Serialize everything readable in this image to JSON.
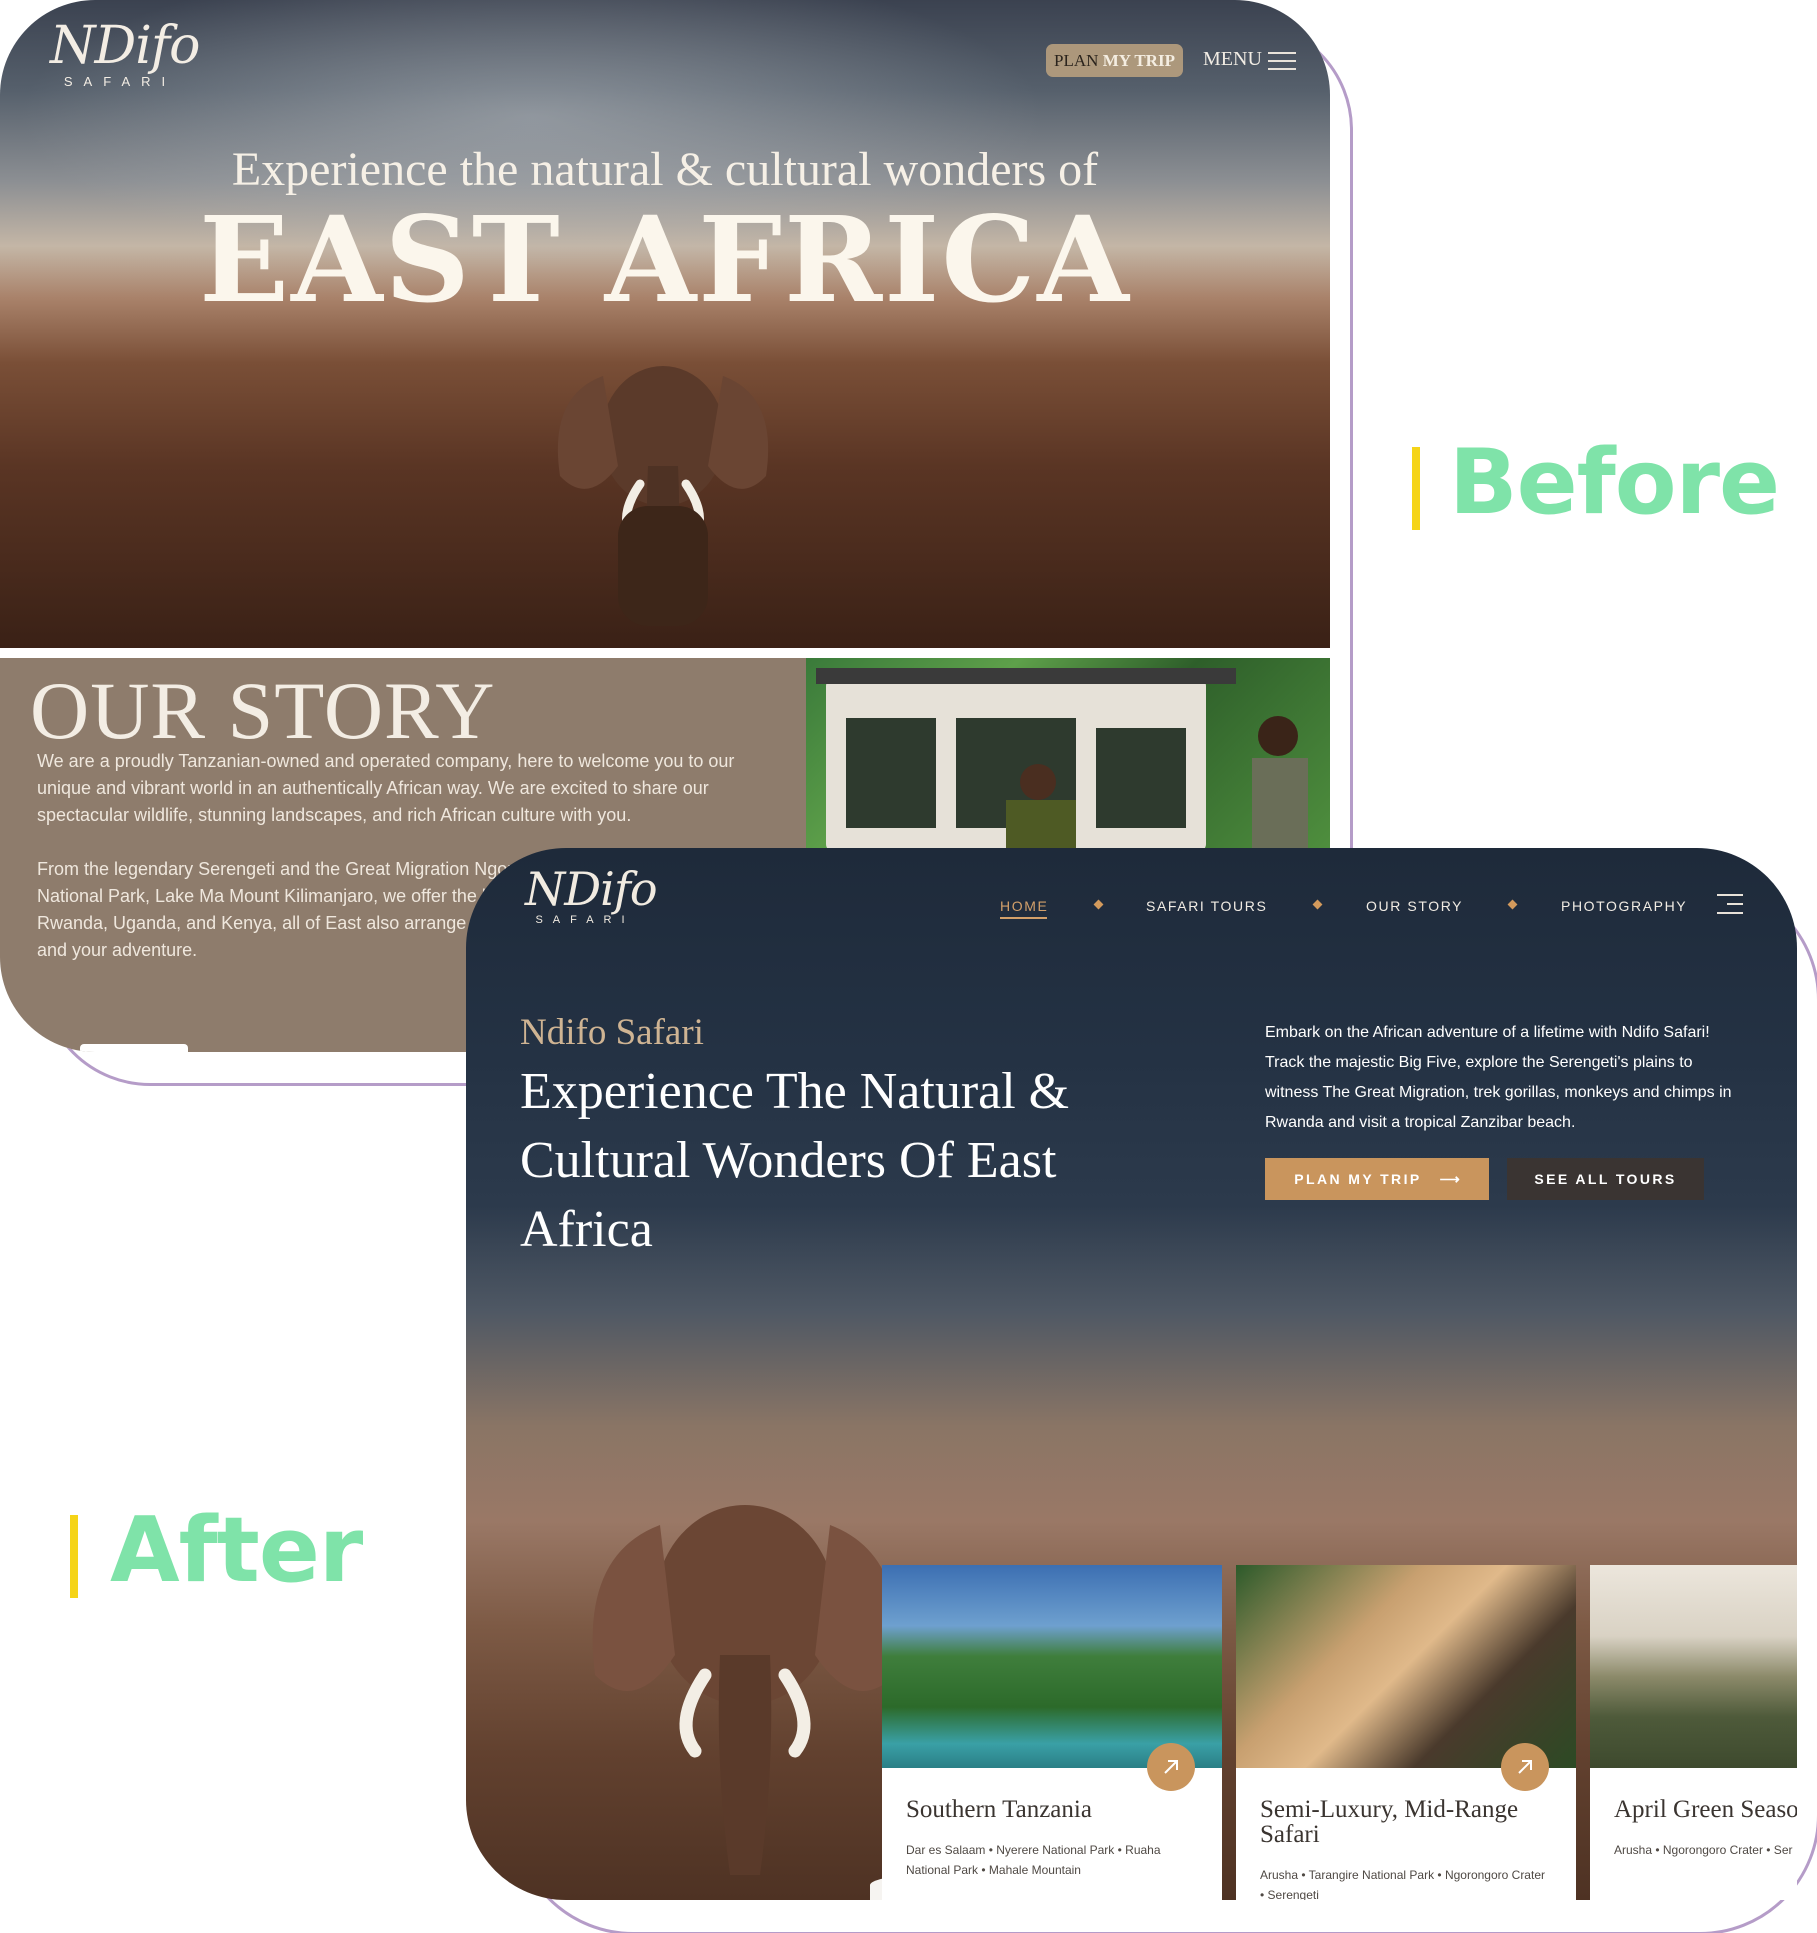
{
  "labels": {
    "before": "Before",
    "after": "After"
  },
  "before": {
    "logo": {
      "mark": "NDifo",
      "sub": "SAFARI"
    },
    "plan_trip": {
      "plan": "PLAN",
      "my_trip": "MY TRIP"
    },
    "menu_label": "MENU",
    "hero": {
      "subtitle": "Experience the natural & cultural wonders of",
      "title": "EAST AFRICA"
    },
    "story": {
      "title": "OUR STORY",
      "p1": "We are a proudly Tanzanian-owned and operated company, here to welcome you to our unique and vibrant world in an authentically African way. We are excited to share our spectacular wildlife, stunning landscapes, and rich African culture with you.",
      "p2": "From the legendary Serengeti and the Great Migration Ngorongoro Crater, Tarangire National Park, Lake Ma Mount Kilimanjaro, we offer the best experiences ou partners in Rwanda, Uganda, and Kenya, all of East also arrange balloon safaris, Kilimanjaro climbs, and your adventure."
    }
  },
  "after": {
    "logo": {
      "mark": "NDifo",
      "sub": "SAFARI"
    },
    "nav": {
      "home": "HOME",
      "safari_tours": "SAFARI TOURS",
      "our_story": "OUR STORY",
      "photography": "PHOTOGRAPHY"
    },
    "hero": {
      "eyebrow": "Ndifo Safari",
      "heading": "Experience The Natural & Cultural Wonders Of East Africa",
      "description": "Embark on the African adventure of a lifetime with Ndifo Safari! Track the majestic Big Five, explore the Serengeti's plains to witness The Great Migration, trek gorillas, monkeys and chimps in Rwanda and visit a tropical Zanzibar beach."
    },
    "buttons": {
      "plan": "PLAN MY TRIP",
      "tours": "SEE ALL TOURS"
    },
    "cards": [
      {
        "title": "Southern Tanzania",
        "meta": "Dar es Salaam • Nyerere National Park • Ruaha National Park • Mahale Mountain"
      },
      {
        "title": "Semi-Luxury, Mid-Range Safari",
        "meta": "Arusha • Tarangire National Park • Ngorongoro Crater • Serengeti"
      },
      {
        "title": "April Green Seaso",
        "meta": "Arusha • Ngorongoro Crater • Ser"
      }
    ]
  },
  "colors": {
    "accent": "#c9955d",
    "label_green": "#7fe3a9",
    "label_bar": "#f5d418",
    "outline": "#b59cc8"
  }
}
